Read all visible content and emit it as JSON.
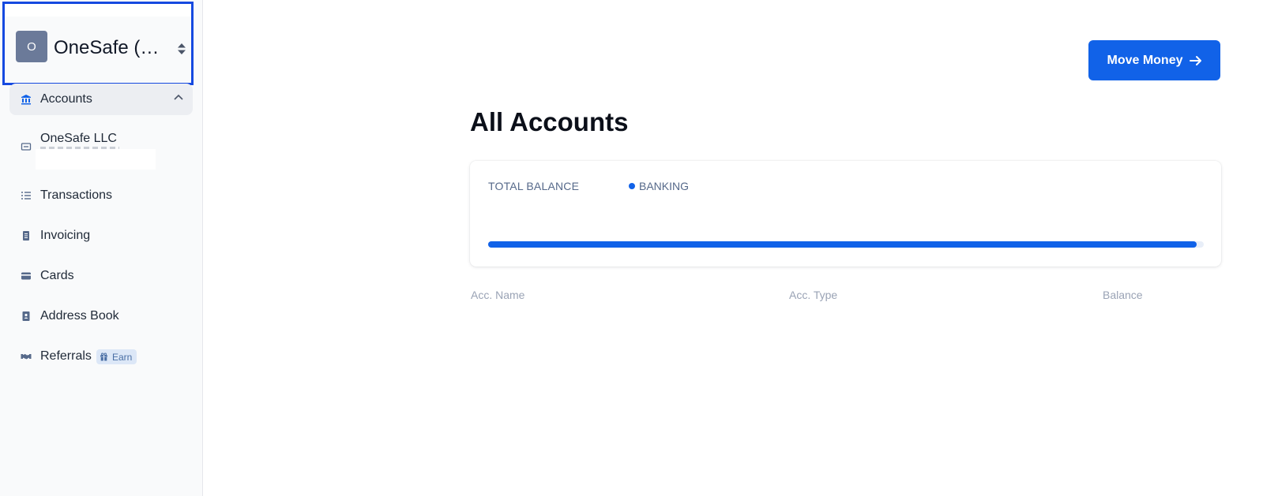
{
  "sidebar": {
    "org": {
      "avatar_letter": "O",
      "name": "OneSafe (R...",
      "sort_icon": "sort-updown-icon"
    },
    "nav": {
      "accounts": {
        "label": "Accounts",
        "icon": "bank-icon"
      },
      "account_onesafe": {
        "label": "OneSafe LLC",
        "icon": "account-card-icon"
      },
      "transactions": {
        "label": "Transactions",
        "icon": "list-icon"
      },
      "invoicing": {
        "label": "Invoicing",
        "icon": "invoice-icon"
      },
      "cards": {
        "label": "Cards",
        "icon": "credit-card-icon"
      },
      "address_book": {
        "label": "Address Book",
        "icon": "contact-book-icon"
      },
      "referrals": {
        "label": "Referrals",
        "icon": "handshake-icon",
        "badge": "Earn"
      }
    }
  },
  "header": {
    "move_money_label": "Move Money"
  },
  "main": {
    "title": "All Accounts",
    "balance_card": {
      "total_label": "TOTAL BALANCE",
      "legend_label": "BANKING",
      "banking_share": 0.99
    },
    "table_headers": [
      "Acc. Name",
      "Acc. Type",
      "Balance"
    ]
  },
  "colors": {
    "accent": "#1162e8",
    "selection_outline": "#1549e0",
    "avatar": "#6b7a99"
  }
}
